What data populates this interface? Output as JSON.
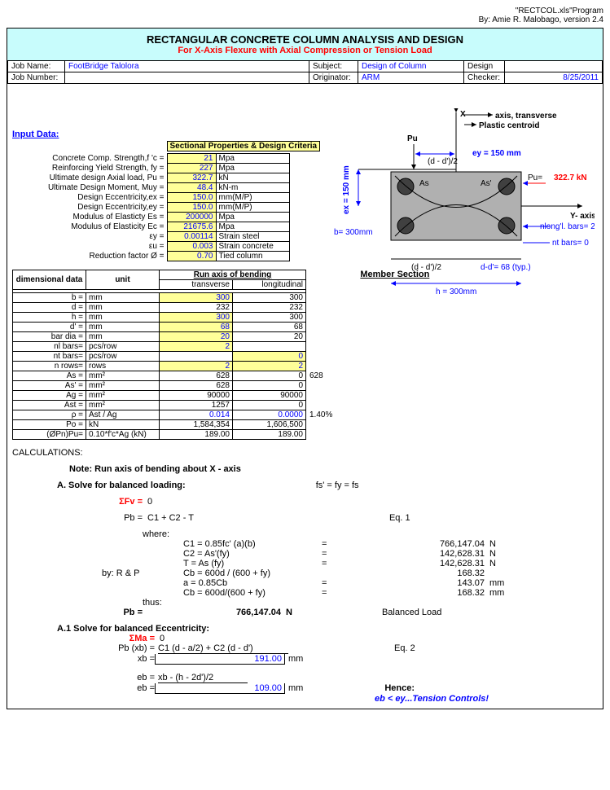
{
  "header": {
    "program": "\"RECTCOL.xls\"Program",
    "by": "By: Amie R. Malobago, version 2.4"
  },
  "title": {
    "main": "RECTANGULAR CONCRETE COLUMN ANALYSIS AND DESIGN",
    "sub": "For X-Axis Flexure with Axial Compression or Tension Load"
  },
  "job": {
    "name_lbl": "Job Name:",
    "name": "FootBridge Talolora",
    "num_lbl": "Job Number:",
    "num": "",
    "subj_lbl": "Subject:",
    "subj": "Design of Column",
    "orig_lbl": "Originator:",
    "orig": "ARM",
    "des_lbl": "Design",
    "chk_lbl": "Checker:",
    "date": "8/25/2011"
  },
  "input_lbl": "Input Data:",
  "sect_head": "Sectional Properties & Design Criteria",
  "props": [
    {
      "lbl": "Concrete Comp. Strength,f 'c =",
      "val": "21",
      "unit": "Mpa"
    },
    {
      "lbl": "Reinforcing Yield Strength, fy =",
      "val": "227",
      "unit": "Mpa"
    },
    {
      "lbl": "Ultimate design Axial load, Pu =",
      "val": "322.7",
      "unit": "kN"
    },
    {
      "lbl": "Ultimate Design Moment, Muy =",
      "val": "48.4",
      "unit": "kN-m"
    },
    {
      "lbl": "Design Eccentricity,ex =",
      "val": "150.0",
      "unit": "mm(M/P)"
    },
    {
      "lbl": "Design Eccentricity,ey =",
      "val": "150.0",
      "unit": "mm(M/P)"
    },
    {
      "lbl": "Modulus of Elasticty Es =",
      "val": "200000",
      "unit": "Mpa"
    },
    {
      "lbl": "Modulus of Elasticity Ec =",
      "val": "21675.6",
      "unit": "Mpa"
    },
    {
      "lbl": "εy =",
      "val": "0.00114",
      "unit": "Strain steel",
      "sub": "steel"
    },
    {
      "lbl": "εu =",
      "val": "0.003",
      "unit": "Strain concrete",
      "sub": "concrete"
    },
    {
      "lbl": "Reduction factor Ø =",
      "val": "0.70",
      "unit": "Tied column"
    }
  ],
  "dim_head": {
    "c1": "dimensional data",
    "c2": "unit",
    "c3": "Run axis of bending",
    "c3a": "transverse",
    "c3b": "longitudinal"
  },
  "dim": [
    {
      "lbl": "b =",
      "unit": "mm",
      "t": "300",
      "l": "300",
      "ty": true
    },
    {
      "lbl": "d =",
      "unit": "mm",
      "t": "232",
      "l": "232"
    },
    {
      "lbl": "h =",
      "unit": "mm",
      "t": "300",
      "l": "300",
      "ty": true
    },
    {
      "lbl": "d' =",
      "unit": "mm",
      "t": "68",
      "l": "68",
      "ty": true
    },
    {
      "lbl": "bar dia =",
      "unit": "mm",
      "t": "20",
      "l": "20",
      "ty": true
    },
    {
      "lbl": "nl bars=",
      "unit": "pcs/row",
      "t": "2",
      "l": "",
      "ty": true
    },
    {
      "lbl": "nt bars=",
      "unit": "pcs/row",
      "t": "",
      "l": "0",
      "ly": true
    },
    {
      "lbl": "n rows=",
      "unit": "rows",
      "t": "2",
      "l": "2",
      "ty": true,
      "ly": true
    },
    {
      "lbl": "As =",
      "unit": "mm²",
      "t": "628",
      "l": "0",
      "ext": "628"
    },
    {
      "lbl": "As' =",
      "unit": "mm²",
      "t": "628",
      "l": "0"
    },
    {
      "lbl": "Ag =",
      "unit": "mm²",
      "t": "90000",
      "l": "90000"
    },
    {
      "lbl": "Ast =",
      "unit": "mm²",
      "t": "1257",
      "l": "0"
    },
    {
      "lbl": "ρ =",
      "unit": "Ast / Ag",
      "t": "0.014",
      "l": "0.0000",
      "tb": true,
      "lb": true,
      "ext": "1.40%"
    },
    {
      "lbl": "Po =",
      "unit": "kN",
      "t": "1,584,354",
      "l": "1,606,500"
    },
    {
      "lbl": "(ØPn)Pu=",
      "unit": "0.10*f'c*Ag (kN)",
      "t": "189.00",
      "l": "189.00"
    }
  ],
  "member_section": "Member Section",
  "diagram": {
    "axis_t": "axis,  transverse",
    "pc": "Plastic centroid",
    "x": "X",
    "pu": "Pu",
    "ey": "ey = 150 mm",
    "ex": "ex = 150 mm",
    "b": "b= 300mm",
    "h": "h = 300mm",
    "pu_val": "322.7 kN",
    "yaxis": "Y- axis",
    "nlong": "nlong'l. bars= 2",
    "ntbars": "nt bars= 0",
    "dd": "(d - d')/2",
    "dd2": "(d - d')/2",
    "ddp": "d-d'= 68 (typ.)",
    "As": "As",
    "Asp": "As'"
  },
  "calc_lbl": "CALCULATIONS:",
  "note": "Note: Run axis of bending about  X - axis",
  "A": {
    "head": "A.  Solve for balanced loading:",
    "fs": "fs'  = fy = fs",
    "sfv": "ΣFv =",
    "z": "0",
    "pb": "Pb =",
    "pbeq": "C1 + C2 - T",
    "eq1": "Eq. 1",
    "where": "where:",
    "c1": "C1 = 0.85fc' (a)(b)",
    "c1v": "766,147.04",
    "n": "N",
    "c2": "C2 =  As'(fy)",
    "c2v": "142,628.31",
    "t": "T =  As (fy)",
    "tv": "142,628.31",
    "byrp": "by: R & P",
    "cb": "Cb =  600d / (600 + fy)",
    "cbv": "168.32",
    "a": "a =  0.85Cb",
    "av": "143.07",
    "mm": "mm",
    "cb2": "Cb =  600d/(600 + fy)",
    "cb2v": "168.32",
    "thus": "thus:",
    "pbr": "Pb =",
    "pbv": "766,147.04",
    "nl": "N",
    "bl": "Balanced Load"
  },
  "A1": {
    "head": "A.1  Solve for balanced Eccentricity:",
    "sma": "ΣMa =",
    "z": "0",
    "pbxb": "Pb (xb) =",
    "pbxbeq": "C1 (d - a/2) + C2 (d - d')",
    "eq2": "Eq. 2",
    "xb": "xb =",
    "xbv": "191.00",
    "mm": "mm",
    "eb1": "eb =",
    "eb1eq": "xb - (h - 2d')/2",
    "eb2": "eb =",
    "eb2v": "109.00",
    "hence": "Hence:",
    "concl": "eb < ey...Tension Controls!"
  }
}
